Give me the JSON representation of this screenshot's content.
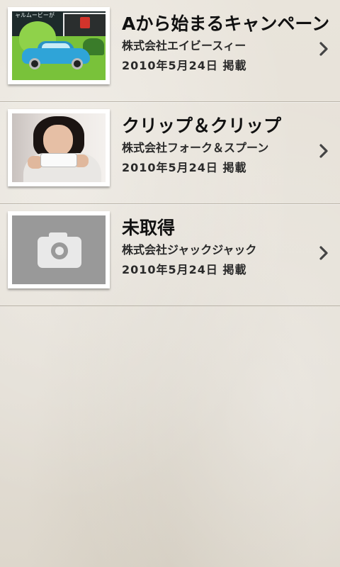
{
  "list": {
    "items": [
      {
        "title": "Aから始まるキャンペーン",
        "company": "株式会社エイビースィー",
        "date": "2010年5月24日 掲載",
        "thumbnail": "car-ad-image",
        "thumbnail_caption": "ャルムービーが"
      },
      {
        "title": "クリップ＆クリップ",
        "company": "株式会社フォーク＆スプーン",
        "date": "2010年5月24日 掲載",
        "thumbnail": "woman-with-phone-photo"
      },
      {
        "title": "未取得",
        "company": "株式会社ジャックジャック",
        "date": "2010年5月24日 掲載",
        "thumbnail": "camera-placeholder-icon"
      }
    ]
  },
  "icons": {
    "chevron": "chevron-right-icon",
    "placeholder": "camera-icon"
  },
  "colors": {
    "background": "#e6e1d8",
    "divider": "#b9b3a8",
    "placeholder_bg": "#999999",
    "title_text": "#111111"
  }
}
